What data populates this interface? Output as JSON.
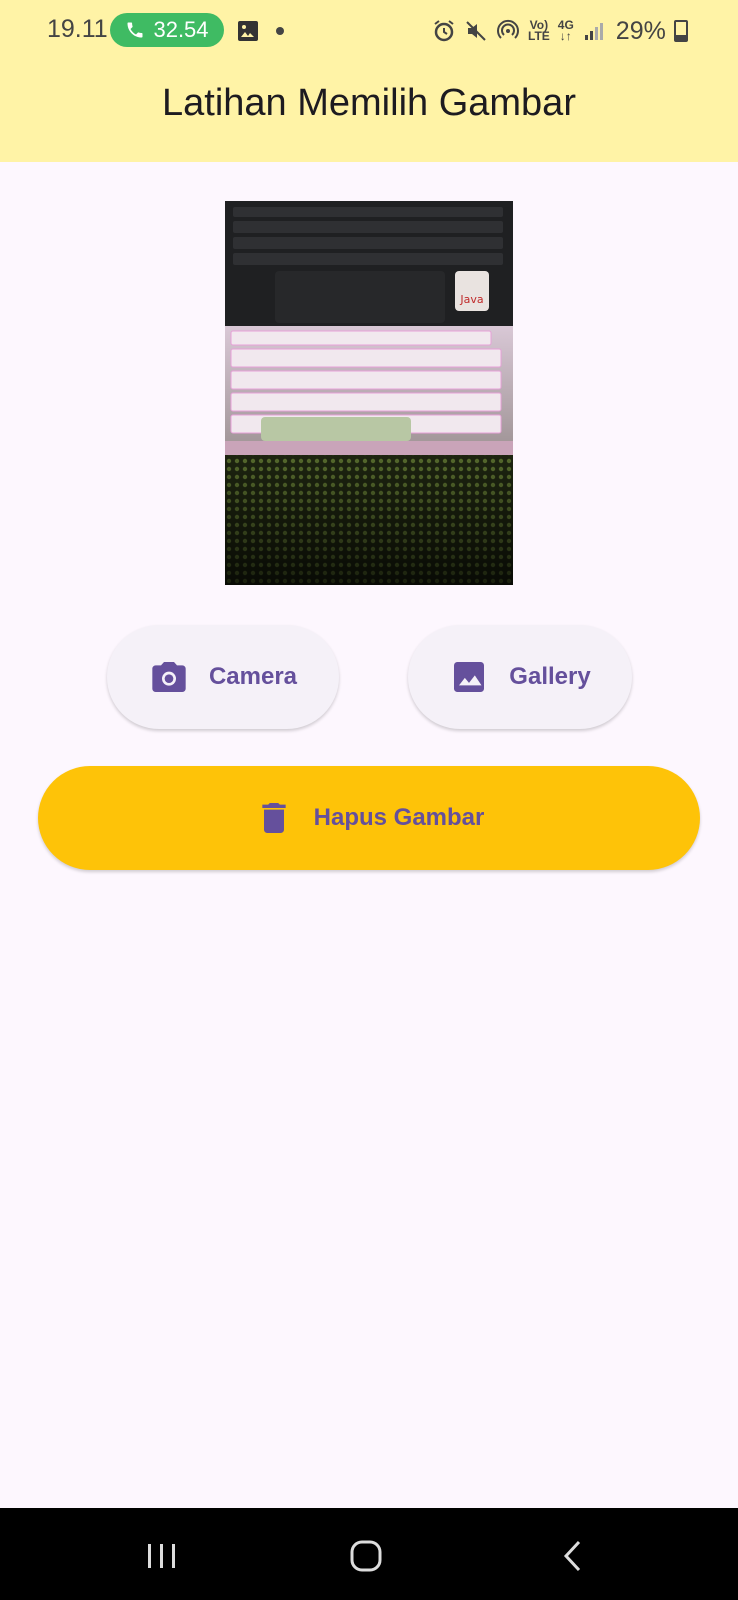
{
  "status_bar": {
    "time": "19.11",
    "call_timer": "32.54",
    "network_top": "Vo)",
    "network_bottom": "LTE",
    "network_type": "4G",
    "battery_percent": "29%"
  },
  "app_bar": {
    "title": "Latihan Memilih Gambar"
  },
  "preview": {
    "image_icon": "keyboard-photo"
  },
  "actions": {
    "camera_label": "Camera",
    "camera_icon": "camera-icon",
    "gallery_label": "Gallery",
    "gallery_icon": "image-icon",
    "delete_label": "Hapus Gambar",
    "delete_icon": "trash-icon"
  },
  "colors": {
    "app_bar_bg": "#fff3a6",
    "page_bg": "#fdf7fe",
    "button_text": "#65509c",
    "delete_bg": "#fec308",
    "call_pill": "#3fbb63"
  }
}
